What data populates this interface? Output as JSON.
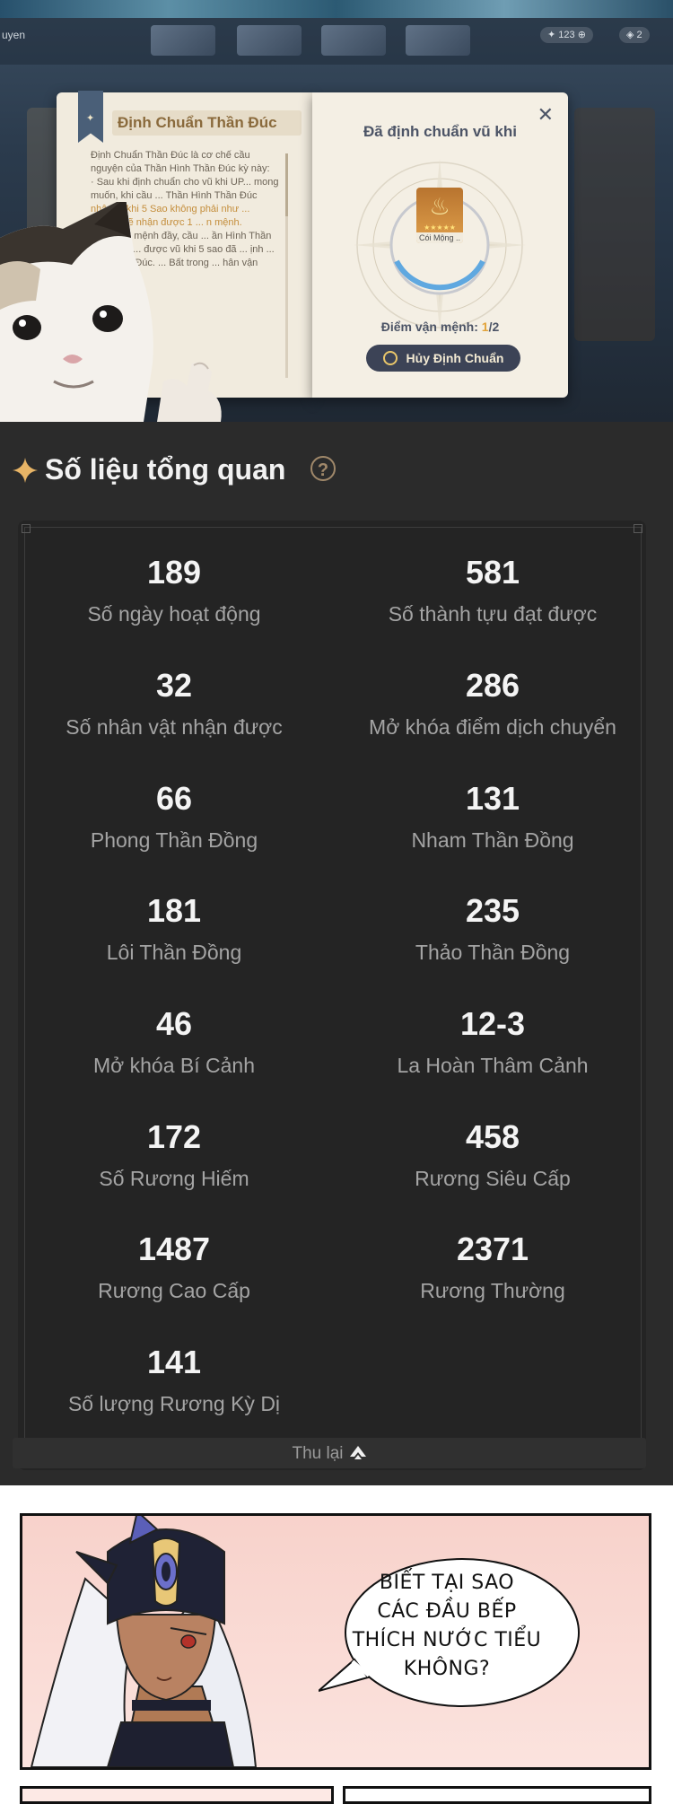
{
  "game": {
    "topbar_text": "uyen",
    "currency_1": "123",
    "currency_2": "2",
    "left_page_title": "Định Chuẩn Thần Đúc",
    "left_page_text_1": "Định Chuẩn Thần Đúc là cơ chế cầu nguyện của Thần Hình Thần Đúc kỳ này:",
    "left_page_text_2": "· Sau khi định chuẩn cho vũ khi UP... mong muốn, khi cầu ... Thần Hình Thần Đúc",
    "left_page_text_hl": "nhận ... khi 5 Sao không phải như ... chuẩn, sẽ nhận được 1 ... n mệnh.",
    "left_page_text_3": "... ên vận mệnh đầy, cầu ... ần Hình Thần Đúc nhất ... được vũ khi 5 sao đã ... ịnh ... uẩn Thần Đúc. ... Bất trong ... hân vận",
    "right_page_title": "Đã định chuẩn vũ khi",
    "weapon_name": "Cói Mộng ..",
    "weapon_stars": "★★★★★",
    "fate_label": "Điểm vận mệnh: ",
    "fate_current": "1",
    "fate_total": "/2",
    "cancel_button": "Hủy Định Chuẩn",
    "close_symbol": "✕",
    "bookmark_symbol": "✦"
  },
  "stats": {
    "title": "Số liệu tổng quan",
    "help_symbol": "?",
    "items": [
      {
        "value": "189",
        "label": "Số ngày hoạt động"
      },
      {
        "value": "581",
        "label": "Số thành tựu đạt được"
      },
      {
        "value": "32",
        "label": "Số nhân vật nhận được"
      },
      {
        "value": "286",
        "label": "Mở khóa điểm dịch chuyển"
      },
      {
        "value": "66",
        "label": "Phong Thần Đồng"
      },
      {
        "value": "131",
        "label": "Nham Thần Đồng"
      },
      {
        "value": "181",
        "label": "Lôi Thần Đồng"
      },
      {
        "value": "235",
        "label": "Thảo Thần Đồng"
      },
      {
        "value": "46",
        "label": "Mở khóa Bí Cảnh"
      },
      {
        "value": "12-3",
        "label": "La Hoàn Thâm Cảnh"
      },
      {
        "value": "172",
        "label": "Số Rương Hiếm"
      },
      {
        "value": "458",
        "label": "Rương Siêu Cấp"
      },
      {
        "value": "1487",
        "label": "Rương Cao Cấp"
      },
      {
        "value": "2371",
        "label": "Rương Thường"
      },
      {
        "value": "141",
        "label": "Số lượng Rương Kỳ Dị"
      }
    ],
    "collapse_label": "Thu lại"
  },
  "comic": {
    "speech_line_1": "BIẾT TẠI SAO",
    "speech_line_2": "CÁC ĐẦU BẾP",
    "speech_line_3": "THÍCH NƯỚC TIỂU",
    "speech_line_4": "KHÔNG?"
  },
  "colors": {
    "stats_bg": "#2b2b2b",
    "card_bg": "#242424",
    "accent_gold": "#e2a33a",
    "comic_bg": "#f8d2cb"
  }
}
